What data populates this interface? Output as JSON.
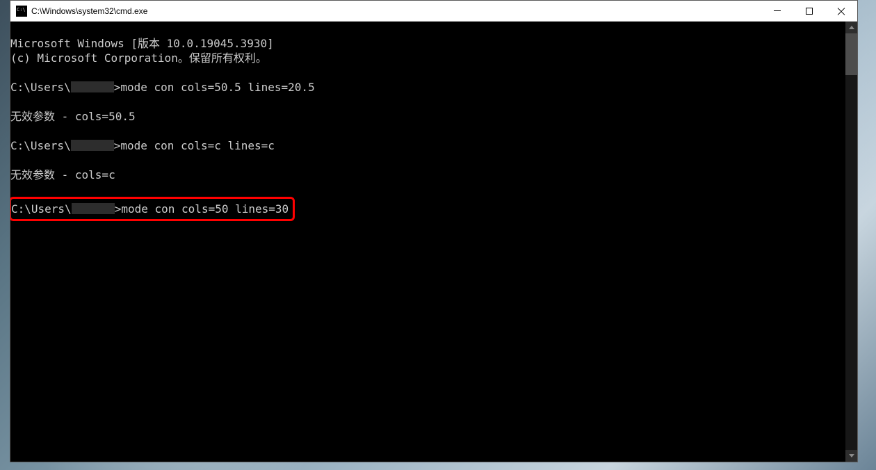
{
  "window": {
    "title": "C:\\Windows\\system32\\cmd.exe"
  },
  "terminal": {
    "header1": "Microsoft Windows [版本 10.0.19045.3930]",
    "header2": "(c) Microsoft Corporation。保留所有权利。",
    "blank": "",
    "prompt_prefix": "C:\\Users\\",
    "prompt_suffix": ">",
    "cmd1": "mode con cols=50.5 lines=20.5",
    "err1": "无效参数 - cols=50.5",
    "cmd2": "mode con cols=c lines=c",
    "err2": "无效参数 - cols=c",
    "cmd3": "mode con cols=50 lines=30"
  }
}
